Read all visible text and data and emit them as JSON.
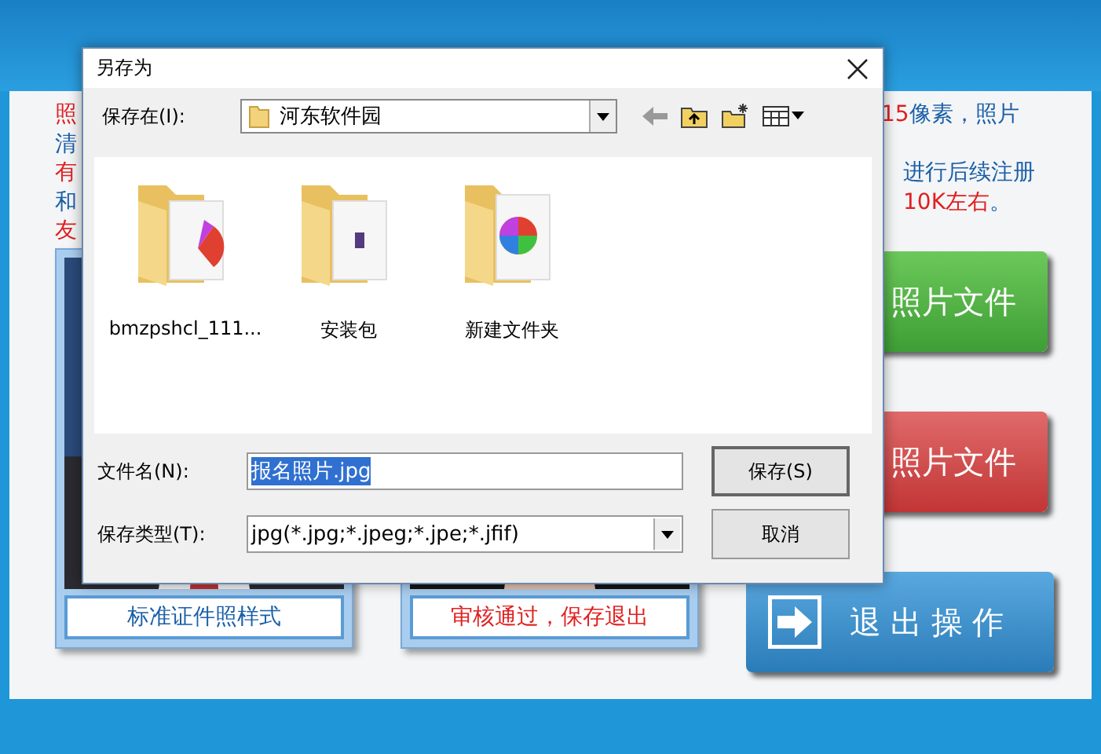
{
  "app": {
    "notes_left": [
      {
        "text": "照",
        "color": "#e02020"
      },
      {
        "text": "清",
        "color": "#1a5fa8"
      },
      {
        "text": "有",
        "color": "#e02020"
      },
      {
        "text": "和",
        "color": "#1a5fa8"
      },
      {
        "text": "友",
        "color": "#e02020"
      }
    ],
    "notes_right": [
      [
        {
          "text": "15",
          "color": "#e02020"
        },
        {
          "text": "像素，照片",
          "color": "#1a5fa8"
        }
      ],
      [
        {
          "text": "进行后续注册",
          "color": "#1a5fa8"
        }
      ],
      [
        {
          "text": "10K左右",
          "color": "#e02020"
        },
        {
          "text": "。",
          "color": "#1a5fa8"
        }
      ]
    ],
    "panels": [
      {
        "caption": "标准证件照样式",
        "color": "#1a5fa8"
      },
      {
        "caption": "审核通过，保存退出",
        "color": "#e02020"
      }
    ],
    "actions": [
      {
        "label": "照片文件",
        "kind": "open"
      },
      {
        "label": "照片文件",
        "kind": "save"
      },
      {
        "label": "退出操作",
        "kind": "exit"
      }
    ]
  },
  "dialog": {
    "title": "另存为",
    "location_label": "保存在(I):",
    "location": "河东软件园",
    "files": [
      {
        "name": "bmzpshcl_111...",
        "kind": "doc"
      },
      {
        "name": "安装包",
        "kind": "archive"
      },
      {
        "name": "新建文件夹",
        "kind": "pie"
      }
    ],
    "filename_label": "文件名(N):",
    "filename": "报名照片.jpg",
    "filename_selected": true,
    "type_label": "保存类型(T):",
    "type": "jpg(*.jpg;*.jpeg;*.jpe;*.jfif)",
    "buttons": [
      {
        "label": "保存(S)",
        "kind": "default"
      },
      {
        "label": "取消",
        "kind": "normal"
      }
    ]
  }
}
